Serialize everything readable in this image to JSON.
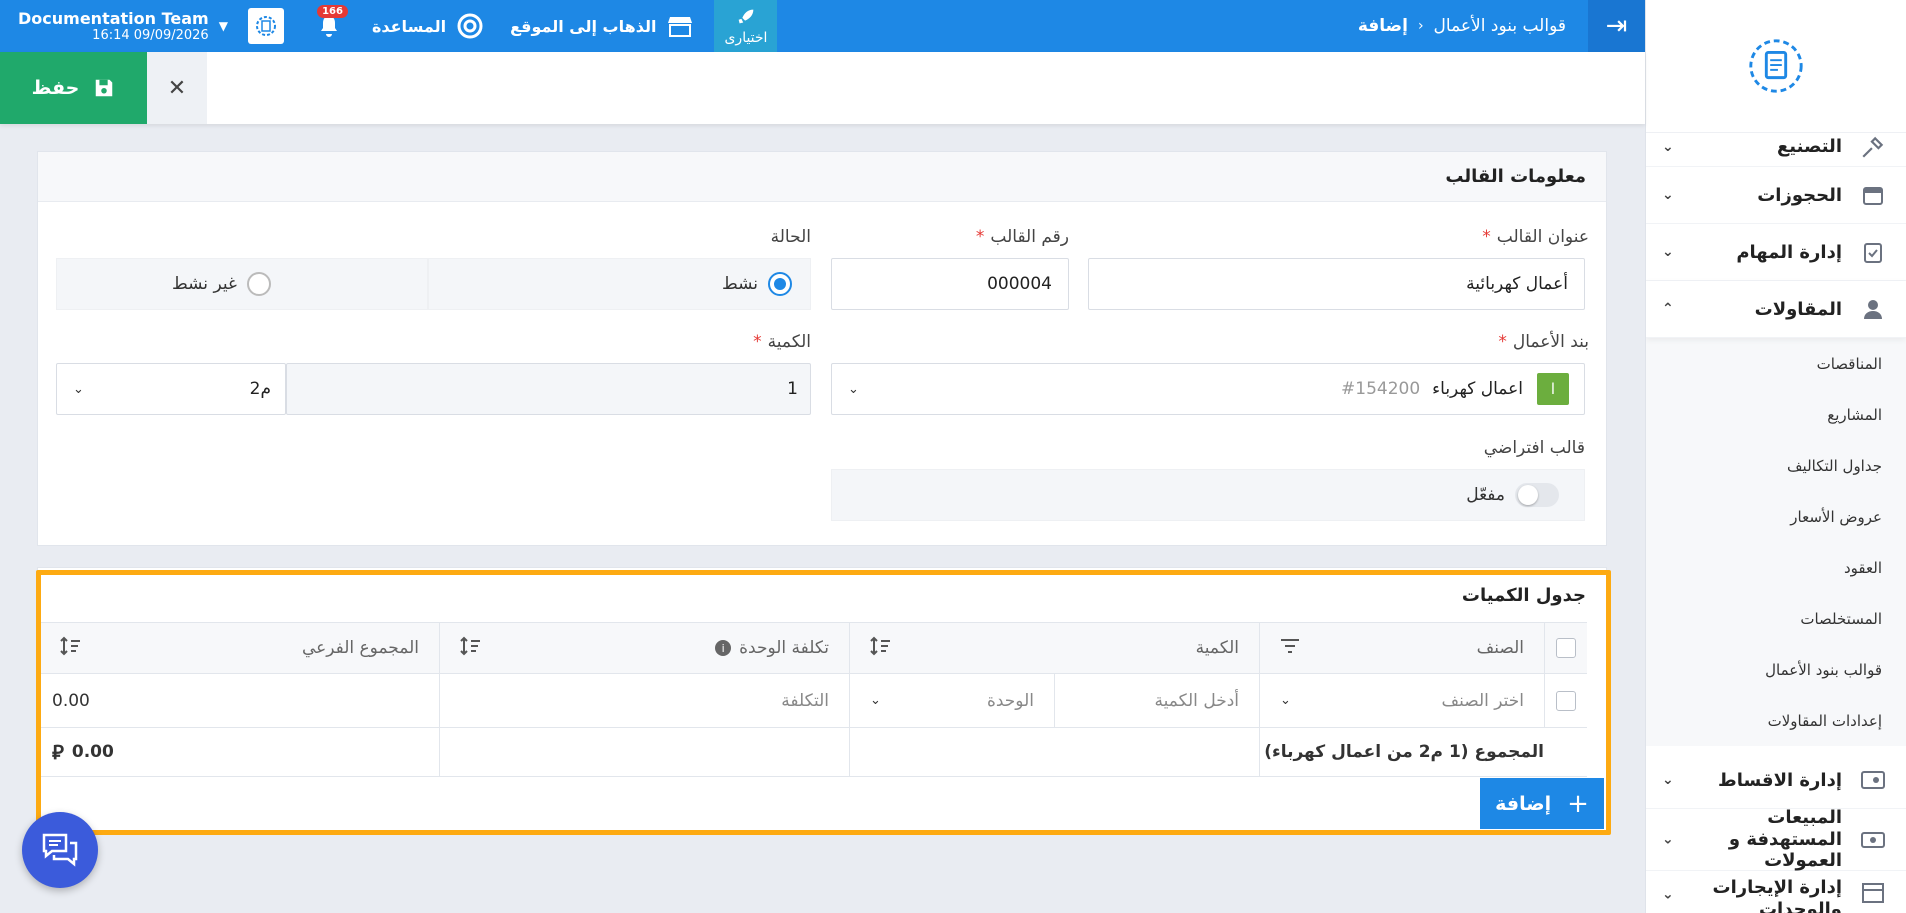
{
  "topbar": {
    "breadcrumb_parent": "قوالب بنود الأعمال",
    "breadcrumb_current": "إضافة",
    "shortcuts_label": "اختيارى",
    "visit_site_label": "الذهاب إلى الموقع",
    "help_label": "المساعدة",
    "notifications_count": "166",
    "user_name": "Documentation Team",
    "user_datetime": "16:14 09/09/2026"
  },
  "actionbar": {
    "save_label": "حفظ"
  },
  "template_info": {
    "title": "معلومات القالب",
    "template_title_label": "عنوان القالب",
    "template_title_value": "أعمال كهربائية",
    "template_number_label": "رقم القالب",
    "template_number_value": "000004",
    "status_label": "الحالة",
    "status_active": "نشط",
    "status_inactive": "غير نشط",
    "work_item_label": "بند الأعمال",
    "work_item_badge": "ا",
    "work_item_name": "اعمال كهرباء",
    "work_item_code": "#154200",
    "quantity_label": "الكمية",
    "quantity_value": "1",
    "unit_value": "م2",
    "default_template_label": "قالب افتراضي",
    "default_toggle_label": "مفعّل"
  },
  "quantities_table": {
    "title": "جدول الكميات",
    "headers": {
      "item": "الصنف",
      "quantity": "الكمية",
      "unit_cost": "تكلفة الوحدة",
      "subtotal": "المجموع الفرعي"
    },
    "row": {
      "item_placeholder": "اختر الصنف",
      "quantity_placeholder": "أدخل الكمية",
      "unit_placeholder": "الوحدة",
      "cost_placeholder": "التكلفة",
      "subtotal": "0.00"
    },
    "total_label": "المجموع (1 م2 من اعمال كهرباء)",
    "total_value": "0.00",
    "currency_symbol": "⃁",
    "add_label": "إضافة"
  },
  "sidebar": {
    "items": [
      {
        "label": "التصنيع"
      },
      {
        "label": "الحجوزات"
      },
      {
        "label": "إدارة المهام"
      },
      {
        "label": "المقاولات"
      }
    ],
    "sub_items": [
      {
        "label": "المناقصات"
      },
      {
        "label": "المشاريع"
      },
      {
        "label": "جداول التكاليف"
      },
      {
        "label": "عروض الأسعار"
      },
      {
        "label": "العقود"
      },
      {
        "label": "المستخلصات"
      },
      {
        "label": "قوالب بنود الأعمال"
      },
      {
        "label": "إعدادات المقاولات"
      }
    ],
    "bottom_items": [
      {
        "label": "إدارة الاقساط"
      },
      {
        "label": "المبيعات المستهدفة و العمولات"
      },
      {
        "label": "إدارة الإيجارات والوحدات"
      }
    ]
  },
  "colors": {
    "brand_blue": "#1e88e5",
    "save_green": "#20a96b",
    "highlight_orange": "#fdaa12"
  }
}
